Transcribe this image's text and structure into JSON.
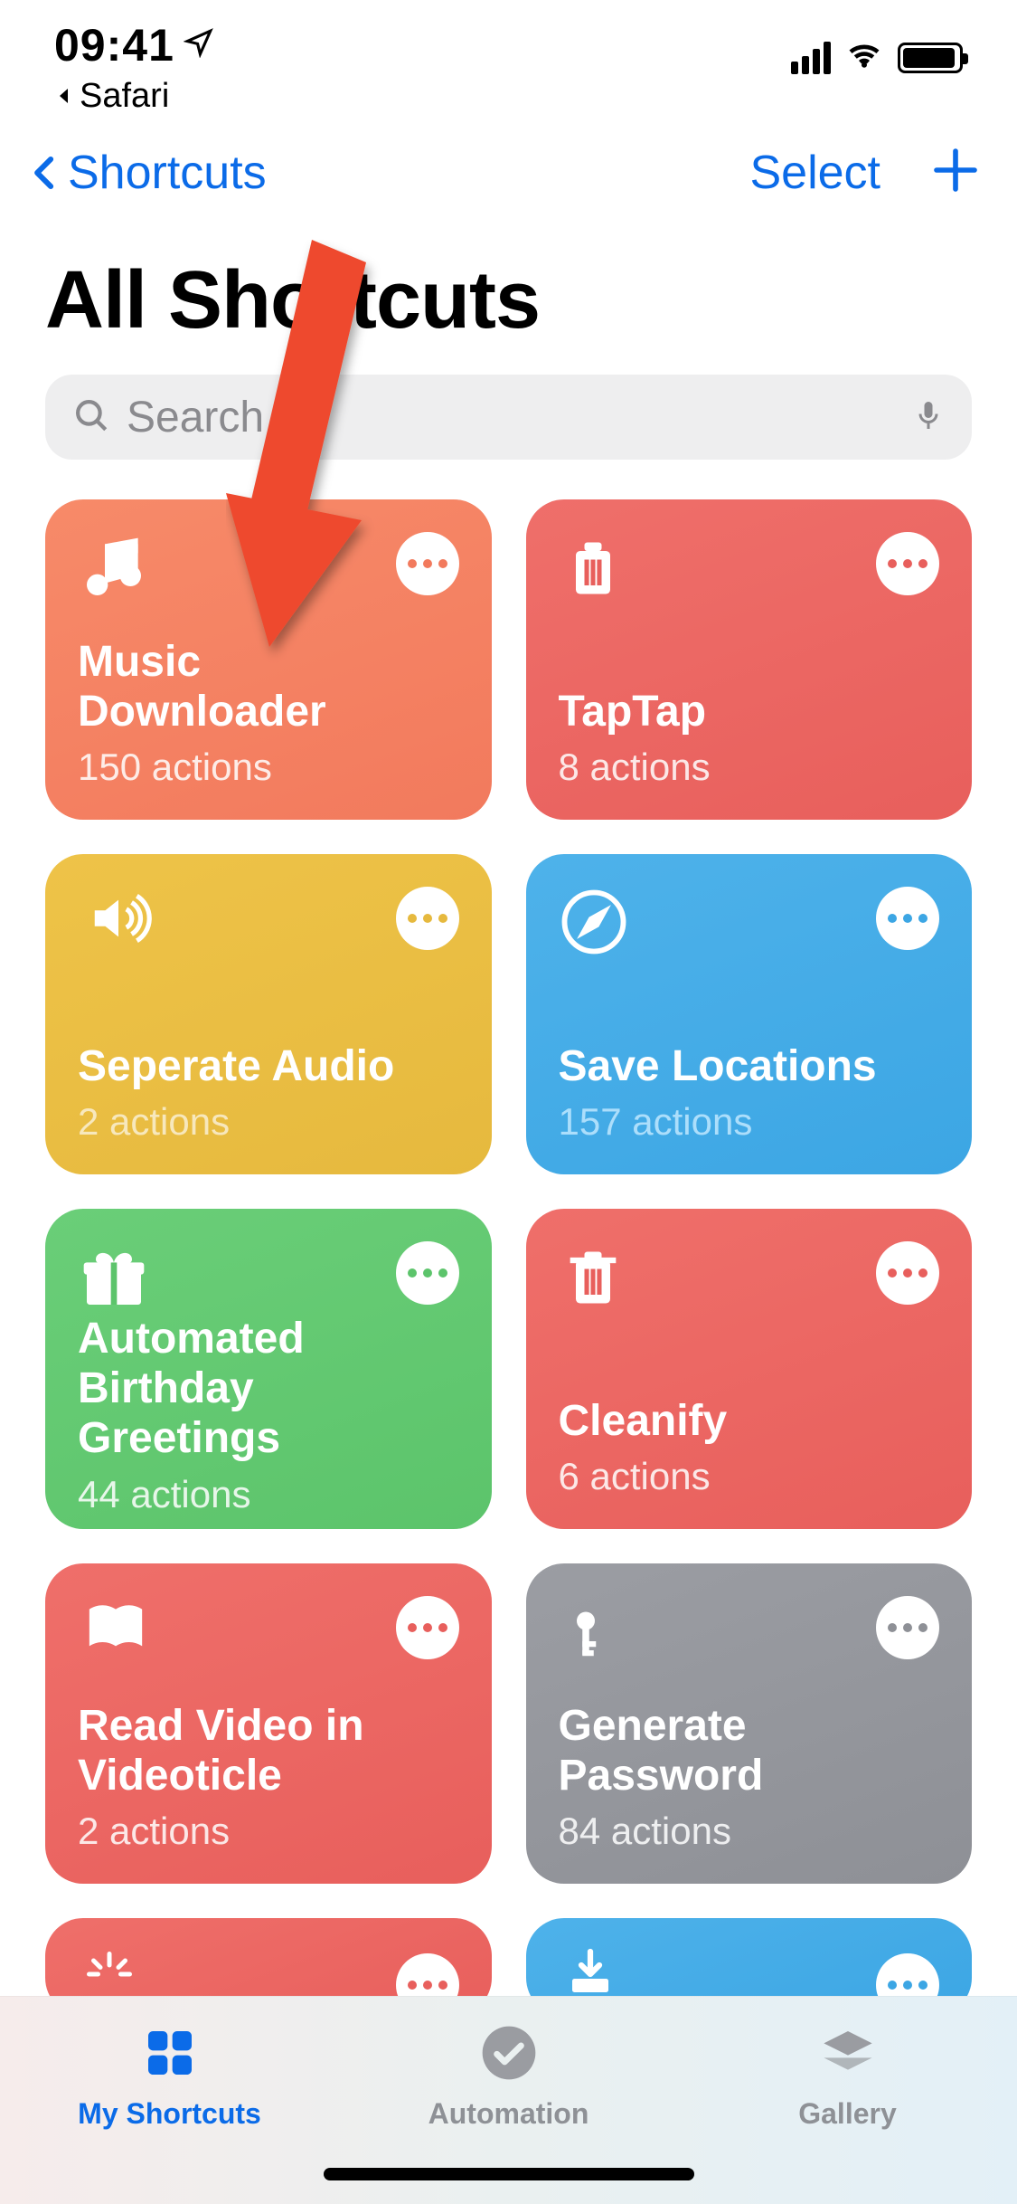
{
  "status": {
    "time": "09:41",
    "back_app": "Safari"
  },
  "nav": {
    "back_label": "Shortcuts",
    "select_label": "Select"
  },
  "title": "All Shortcuts",
  "search": {
    "placeholder": "Search"
  },
  "cards": [
    {
      "title": "Music Downloader",
      "sub": "150 actions"
    },
    {
      "title": "TapTap",
      "sub": "8 actions"
    },
    {
      "title": "Seperate Audio",
      "sub": "2 actions"
    },
    {
      "title": "Save Locations",
      "sub": "157 actions"
    },
    {
      "title": "Automated Birthday Greetings",
      "sub": "44 actions"
    },
    {
      "title": "Cleanify",
      "sub": "6 actions"
    },
    {
      "title": "Read Video in Videoticle",
      "sub": "2 actions"
    },
    {
      "title": "Generate Password",
      "sub": "84 actions"
    }
  ],
  "tabs": {
    "my_shortcuts": "My Shortcuts",
    "automation": "Automation",
    "gallery": "Gallery"
  }
}
